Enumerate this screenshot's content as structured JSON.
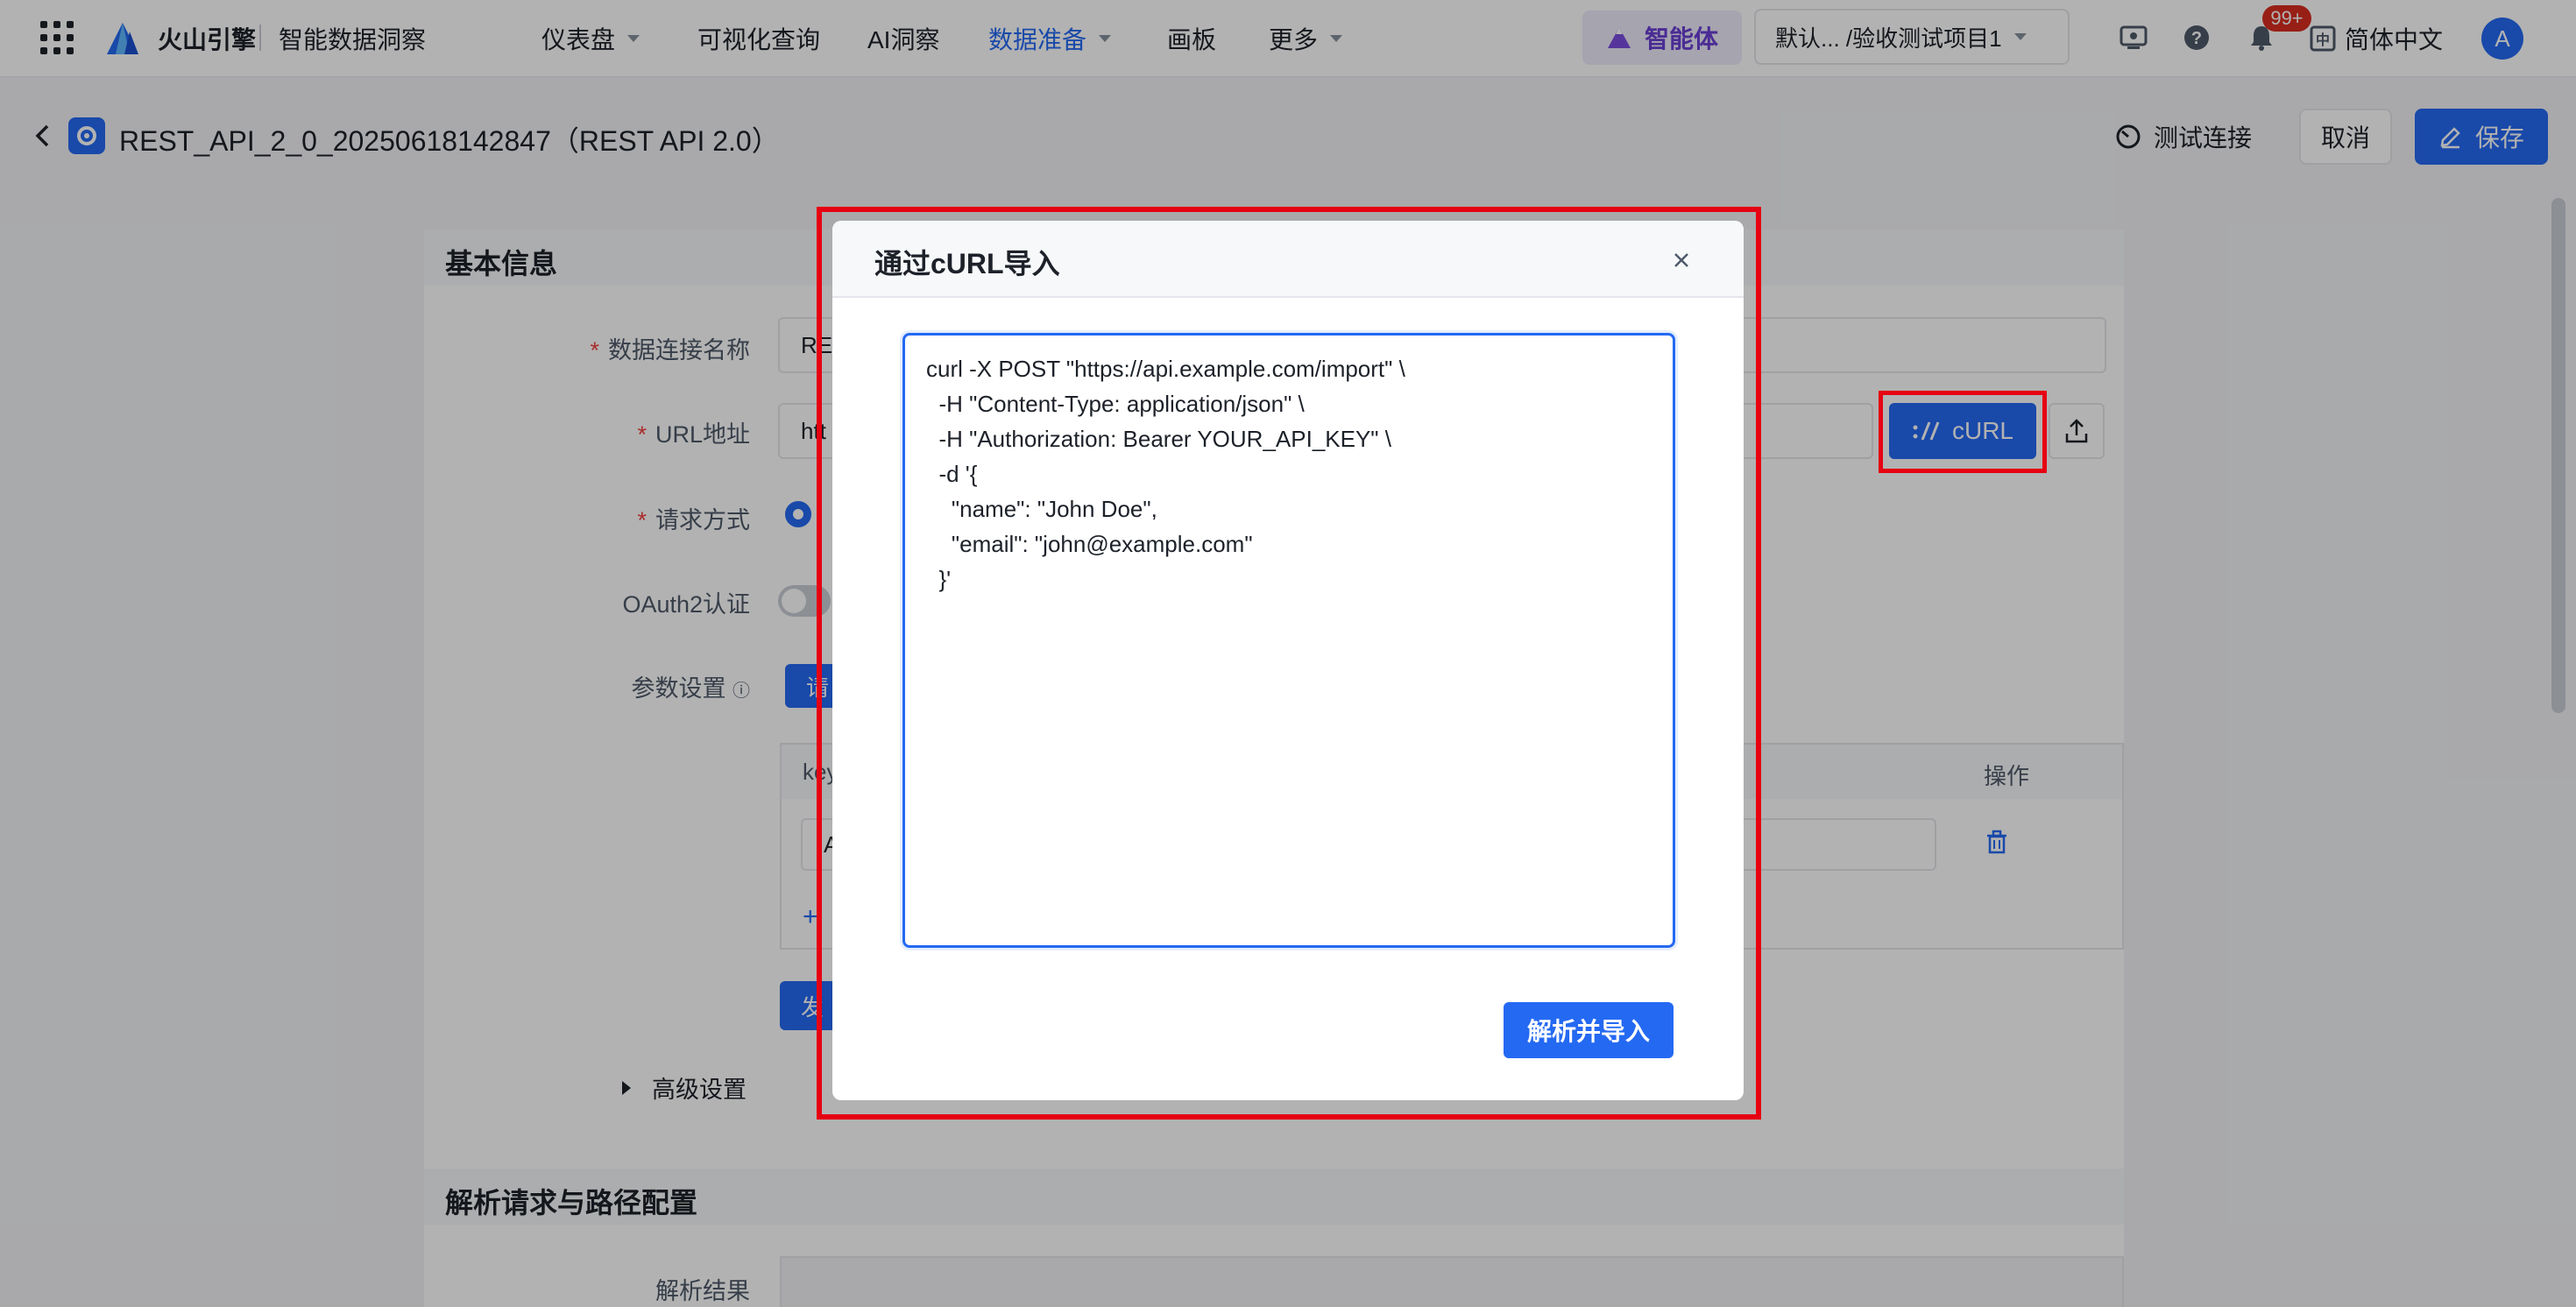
{
  "topnav": {
    "brand": "火山引擎",
    "product": "智能数据洞察",
    "items": [
      {
        "label": "仪表盘",
        "has_caret": true,
        "active": false
      },
      {
        "label": "可视化查询",
        "has_caret": false,
        "active": false
      },
      {
        "label": "AI洞察",
        "has_caret": false,
        "active": false
      },
      {
        "label": "数据准备",
        "has_caret": true,
        "active": true
      },
      {
        "label": "画板",
        "has_caret": false,
        "active": false
      },
      {
        "label": "更多",
        "has_caret": true,
        "active": false
      }
    ],
    "agent_label": "智能体",
    "project_selector": "默认...   /验收测试项目1",
    "notification_badge": "99+",
    "language": "简体中文",
    "avatar_initial": "A",
    "accent_color": "#2469f2"
  },
  "subheader": {
    "title": "REST_API_2_0_20250618142847（REST API 2.0）",
    "test_connection": "测试连接",
    "cancel": "取消",
    "save": "保存"
  },
  "form": {
    "section_basic": "基本信息",
    "name_label": "数据连接名称",
    "name_value": "RE",
    "url_label": "URL地址",
    "url_value": "htt",
    "method_label": "请求方式",
    "oauth_label": "OAuth2认证",
    "params_label": "参数设置",
    "params_button": "请",
    "table_key_header": "key",
    "table_action_header": "操作",
    "row_key_value": "A",
    "add_row": "+",
    "send_button": "发",
    "advanced": "高级设置",
    "section_parse": "解析请求与路径配置",
    "parse_result_label": "解析结果",
    "curl_button": "cURL"
  },
  "modal": {
    "title": "通过cURL导入",
    "curl_text": "curl -X POST \"https://api.example.com/import\" \\\n  -H \"Content-Type: application/json\" \\\n  -H \"Authorization: Bearer YOUR_API_KEY\" \\\n  -d '{\n    \"name\": \"John Doe\",\n    \"email\": \"john@example.com\"\n  }'\n\n",
    "parse_button": "解析并导入"
  }
}
